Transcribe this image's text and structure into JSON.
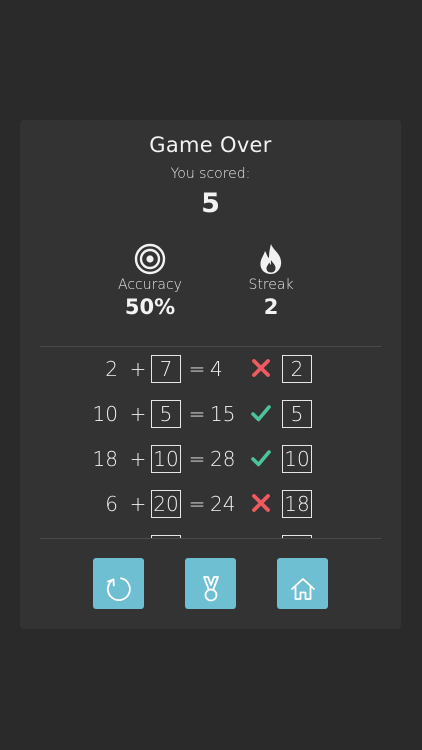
{
  "game_over": {
    "title": "Game Over",
    "subtitle": "You scored:",
    "score": "5"
  },
  "stats": {
    "accuracy": {
      "icon": "target-icon",
      "label": "Accuracy",
      "value": "50%"
    },
    "streak": {
      "icon": "flame-icon",
      "label": "Streak",
      "value": "2"
    }
  },
  "equations": [
    {
      "a": "2",
      "op": "+",
      "b": "7",
      "eq": "=",
      "result": "4",
      "status": "wrong",
      "answer": "2"
    },
    {
      "a": "10",
      "op": "+",
      "b": "5",
      "eq": "=",
      "result": "15",
      "status": "correct",
      "answer": "5"
    },
    {
      "a": "18",
      "op": "+",
      "b": "10",
      "eq": "=",
      "result": "28",
      "status": "correct",
      "answer": "10"
    },
    {
      "a": "6",
      "op": "+",
      "b": "20",
      "eq": "=",
      "result": "24",
      "status": "wrong",
      "answer": "18"
    }
  ],
  "buttons": {
    "restart": {
      "icon": "restart-icon"
    },
    "leaderboard": {
      "icon": "medal-icon"
    },
    "home": {
      "icon": "home-icon"
    }
  },
  "colors": {
    "background": "#2a2a2a",
    "card": "#333333",
    "accent": "#6fbfd3",
    "correct": "#4cc49a",
    "wrong": "#ee5a5f"
  }
}
